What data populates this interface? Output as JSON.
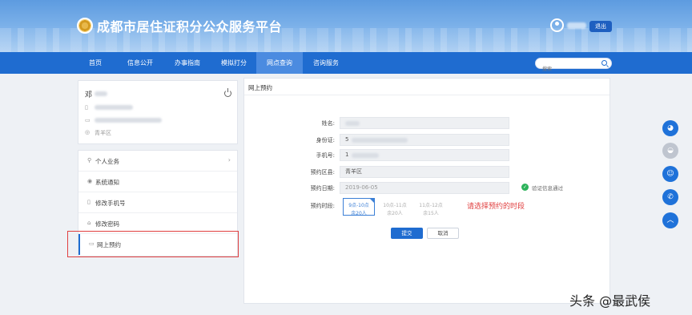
{
  "header": {
    "site_title": "成都市居住证积分公众服务平台",
    "logout_label": "退出"
  },
  "nav": {
    "items": [
      {
        "label": "首页"
      },
      {
        "label": "信息公开"
      },
      {
        "label": "办事指南"
      },
      {
        "label": "模拟打分"
      },
      {
        "label": "网点查询"
      },
      {
        "label": "咨询服务"
      }
    ],
    "active_index": 4,
    "search_placeholder": "搜索"
  },
  "profile": {
    "name": "邓",
    "district": "青羊区"
  },
  "menu": {
    "items": [
      {
        "label": "个人业务",
        "icon": "user-icon",
        "has_chevron": true
      },
      {
        "label": "系统通知",
        "icon": "eye-icon"
      },
      {
        "label": "修改手机号",
        "icon": "phone-icon"
      },
      {
        "label": "修改密码",
        "icon": "lock-icon"
      },
      {
        "label": "网上预约",
        "icon": "laptop-icon",
        "active": true
      }
    ]
  },
  "form": {
    "title": "网上预约",
    "labels": {
      "name": "姓名:",
      "id_card": "身份证:",
      "phone": "手机号:",
      "district": "预约区县:",
      "date": "预约日期:",
      "slot": "预约时段:"
    },
    "values": {
      "id_card_prefix": "5",
      "phone_prefix": "1",
      "district": "青羊区",
      "date": "2019-06-05"
    },
    "verify_text": "验证信息通过",
    "slots": [
      {
        "time": "9点-10点",
        "count": "余20人",
        "selected": true
      },
      {
        "time": "10点-11点",
        "count": "余20人"
      },
      {
        "time": "11点-12点",
        "count": "余15人"
      }
    ],
    "hint": "请选择预约的时段",
    "submit_label": "提交",
    "cancel_label": "取消"
  },
  "sidebar_float": {
    "icons": [
      "wechat-icon",
      "weibo-icon",
      "qq-icon",
      "phone-icon",
      "back-to-top-icon"
    ]
  },
  "watermark": "头条 @最武侯",
  "colors": {
    "nav_blue": "#1f6cd0",
    "highlight_red": "#e04040",
    "verify_green": "#2db35b"
  }
}
